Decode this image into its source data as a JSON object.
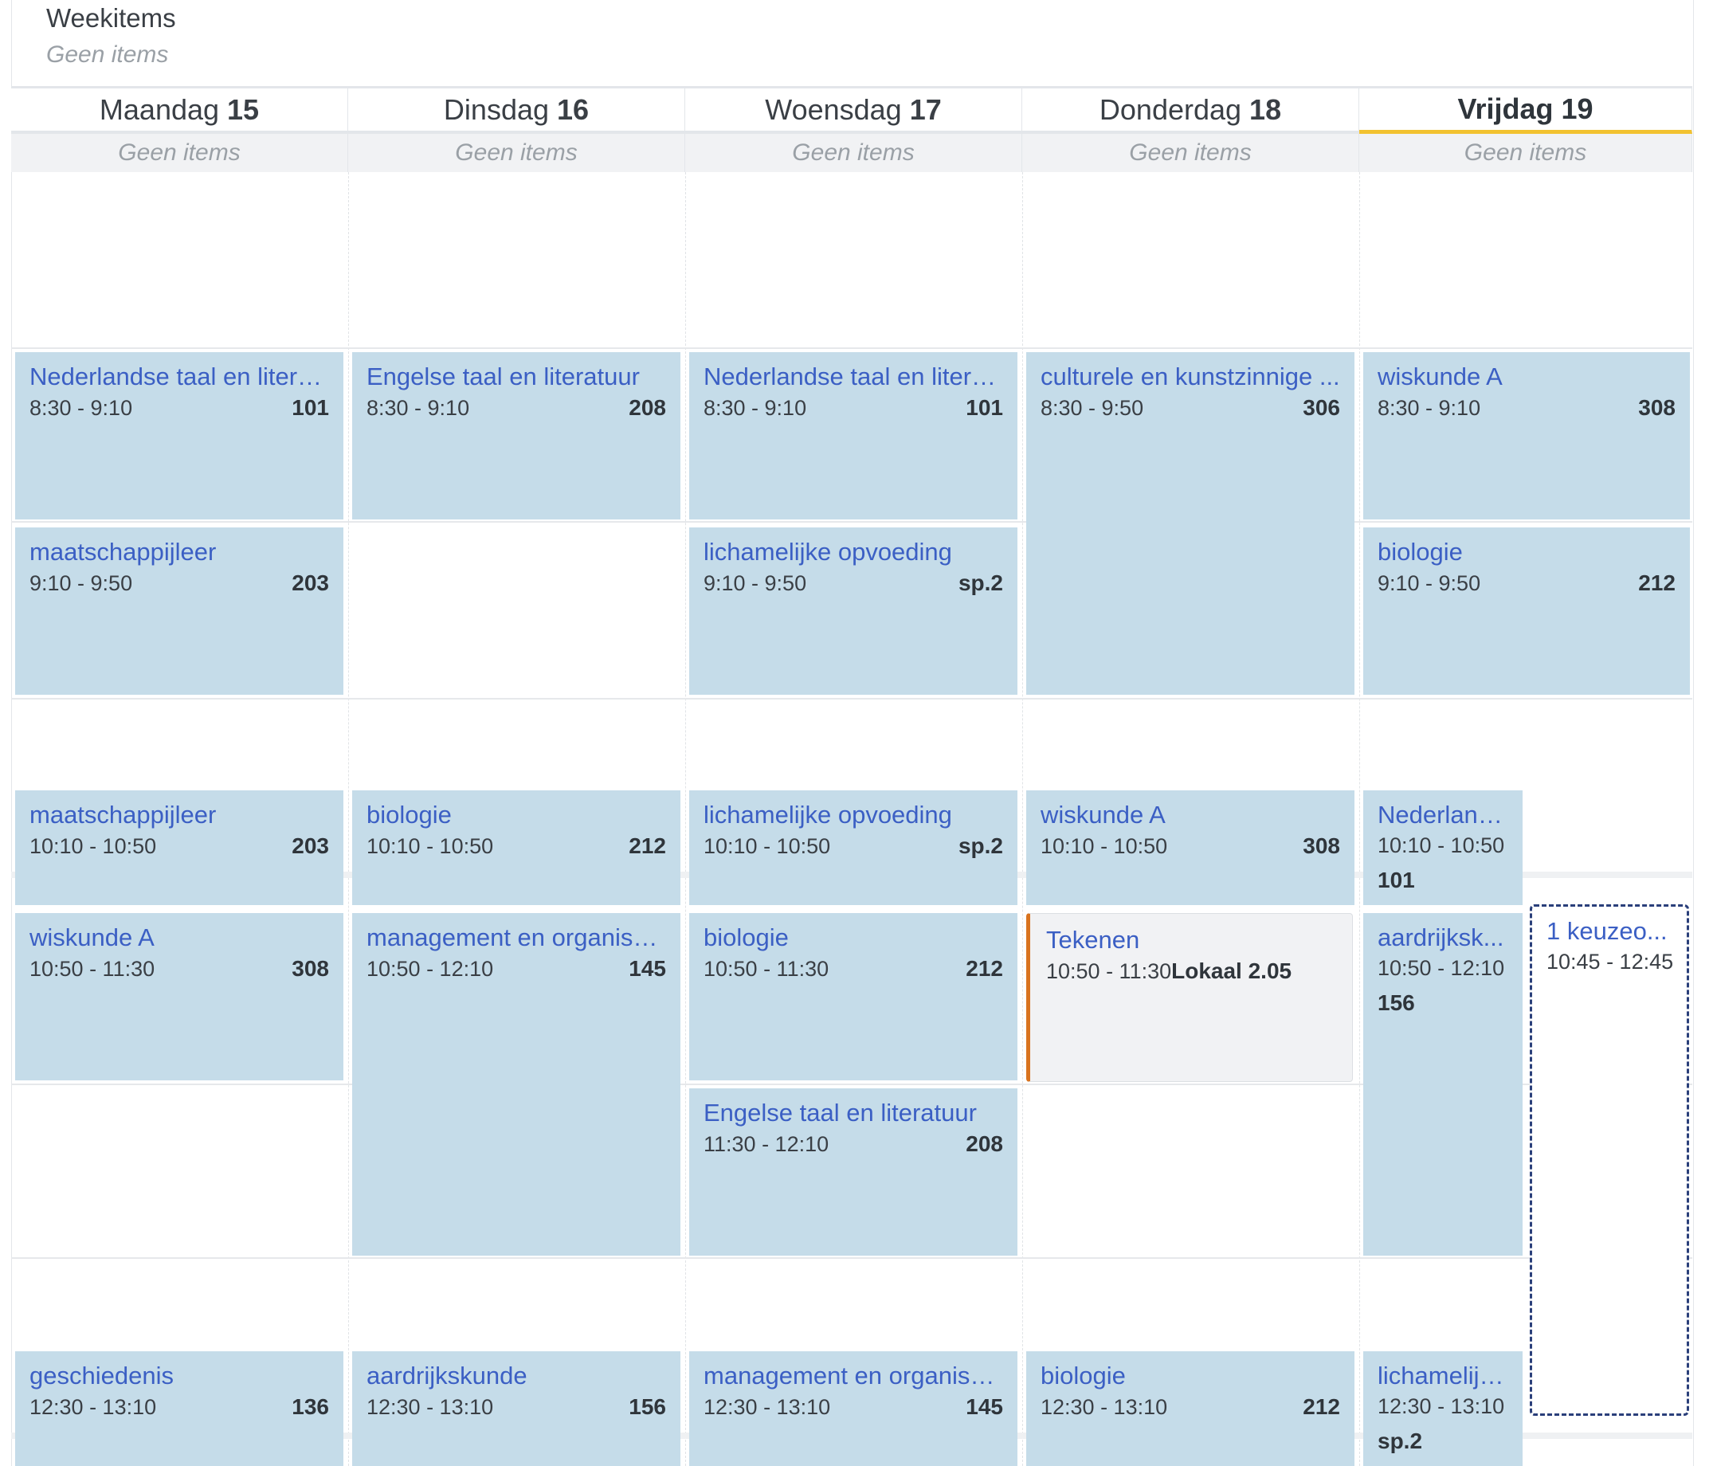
{
  "weekitems": {
    "title": "Weekitems",
    "empty": "Geen items"
  },
  "days": [
    {
      "name": "Maandag",
      "num": "15",
      "items": "Geen items"
    },
    {
      "name": "Dinsdag",
      "num": "16",
      "items": "Geen items"
    },
    {
      "name": "Woensdag",
      "num": "17",
      "items": "Geen items"
    },
    {
      "name": "Donderdag",
      "num": "18",
      "items": "Geen items"
    },
    {
      "name": "Vrijdag",
      "num": "19",
      "items": "Geen items",
      "today": true
    }
  ],
  "lessons": {
    "mon": [
      {
        "title": "Nederlandse taal en literat...",
        "time": "8:30 - 9:10",
        "room": "101"
      },
      {
        "title": "maatschappijleer",
        "time": "9:10 - 9:50",
        "room": "203"
      },
      {
        "title": "maatschappijleer",
        "time": "10:10 - 10:50",
        "room": "203"
      },
      {
        "title": "wiskunde A",
        "time": "10:50 - 11:30",
        "room": "308"
      },
      {
        "title": "geschiedenis",
        "time": "12:30 - 13:10",
        "room": "136"
      }
    ],
    "tue": [
      {
        "title": "Engelse taal en literatuur",
        "time": "8:30 - 9:10",
        "room": "208"
      },
      {
        "title": "biologie",
        "time": "10:10 - 10:50",
        "room": "212"
      },
      {
        "title": "management en organisatie",
        "time": "10:50 - 12:10",
        "room": "145"
      },
      {
        "title": "aardrijkskunde",
        "time": "12:30 - 13:10",
        "room": "156"
      }
    ],
    "wed": [
      {
        "title": "Nederlandse taal en literat...",
        "time": "8:30 - 9:10",
        "room": "101"
      },
      {
        "title": "lichamelijke opvoeding",
        "time": "9:10 - 9:50",
        "room": "sp.2"
      },
      {
        "title": "lichamelijke opvoeding",
        "time": "10:10 - 10:50",
        "room": "sp.2"
      },
      {
        "title": "biologie",
        "time": "10:50 - 11:30",
        "room": "212"
      },
      {
        "title": "Engelse taal en literatuur",
        "time": "11:30 - 12:10",
        "room": "208"
      },
      {
        "title": "management en organisatie",
        "time": "12:30 - 13:10",
        "room": "145"
      }
    ],
    "thu": [
      {
        "title": "culturele en kunstzinnige ...",
        "time": "8:30 - 9:50",
        "room": "306"
      },
      {
        "title": "wiskunde A",
        "time": "10:10 - 10:50",
        "room": "308"
      },
      {
        "title": "biologie",
        "time": "12:30 - 13:10",
        "room": "212"
      }
    ],
    "fri": [
      {
        "title": "wiskunde A",
        "time": "8:30 - 9:10",
        "room": "308"
      },
      {
        "title": "biologie",
        "time": "9:10 - 9:50",
        "room": "212"
      },
      {
        "title": "Nederland...",
        "time": "10:10 - 10:50",
        "room": "101"
      },
      {
        "title": "aardrijksk...",
        "time": "10:50 - 12:10",
        "room": "156"
      },
      {
        "title": "lichamelijk...",
        "time": "12:30 - 13:10",
        "room": "sp.2"
      }
    ]
  },
  "appointment": {
    "title": "Tekenen",
    "time": "10:50 - 11:30",
    "location": "Lokaal 2.05",
    "accent": "#d9731f"
  },
  "choice": {
    "title": "1 keuzeo...",
    "time": "10:45 - 12:45",
    "border": "#2a3f7a"
  },
  "colors": {
    "lesson_bg": "#c5dce9",
    "link": "#3b5fc4",
    "today_underline": "#f2c230"
  }
}
